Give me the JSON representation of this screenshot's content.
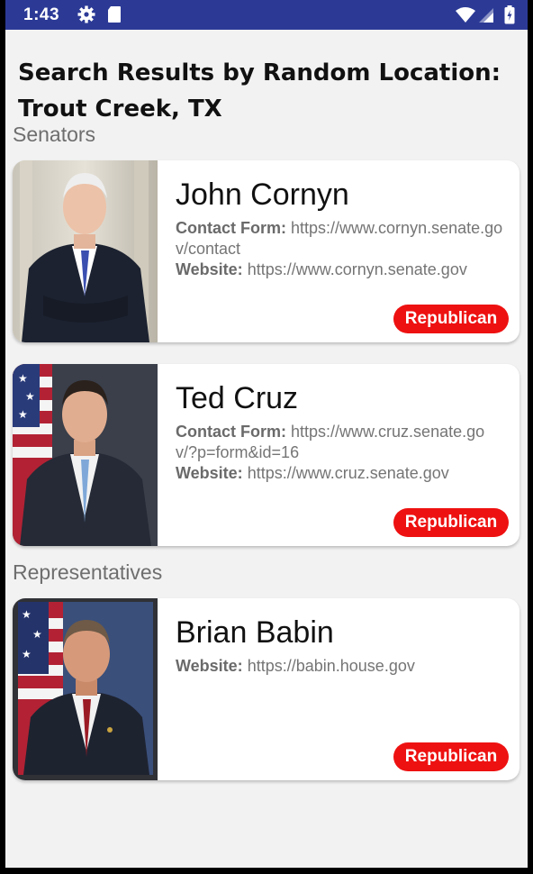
{
  "status_bar": {
    "time": "1:43",
    "icons": [
      "gear-icon",
      "sd-card-icon",
      "wifi-icon",
      "signal-icon",
      "battery-icon"
    ]
  },
  "header": {
    "title": "Search Results by Random Location: Trout Creek, TX"
  },
  "senators": {
    "label": "Senators",
    "items": [
      {
        "name": "John Cornyn",
        "contact_label": "Contact Form:",
        "contact_value": "https://www.cornyn.senate.gov/contact",
        "website_label": "Website:",
        "website_value": "https://www.cornyn.senate.gov",
        "party": "Republican"
      },
      {
        "name": "Ted Cruz",
        "contact_label": "Contact Form:",
        "contact_value": "https://www.cruz.senate.gov/?p=form&id=16",
        "website_label": "Website:",
        "website_value": "https://www.cruz.senate.gov",
        "party": "Republican"
      }
    ]
  },
  "representatives": {
    "label": "Representatives",
    "items": [
      {
        "name": "Brian Babin",
        "website_label": "Website:",
        "website_value": "https://babin.house.gov",
        "party": "Republican"
      }
    ]
  },
  "colors": {
    "status_bar": "#2c3a96",
    "background": "#f2f2f2",
    "party_badge": "#ee1111"
  }
}
